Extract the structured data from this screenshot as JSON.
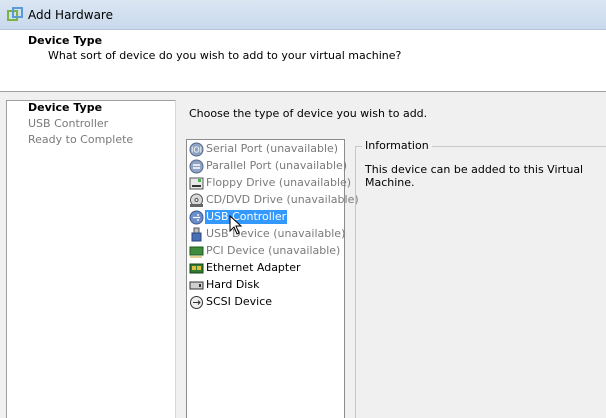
{
  "window": {
    "title": "Add Hardware",
    "icon": "vmware-logo-icon"
  },
  "header": {
    "title": "Device Type",
    "subtitle": "What sort of device do you wish to add to your virtual machine?"
  },
  "steps": [
    {
      "label": "Device Type",
      "state": "active"
    },
    {
      "label": "USB Controller",
      "state": "pending"
    },
    {
      "label": "Ready to Complete",
      "state": "pending"
    }
  ],
  "main": {
    "instruction": "Choose the type of device you wish to add.",
    "devices": [
      {
        "label": "Serial Port (unavailable)",
        "icon": "serial-port-icon",
        "available": false,
        "selected": false
      },
      {
        "label": "Parallel Port (unavailable)",
        "icon": "parallel-port-icon",
        "available": false,
        "selected": false
      },
      {
        "label": "Floppy Drive (unavailable)",
        "icon": "floppy-drive-icon",
        "available": false,
        "selected": false
      },
      {
        "label": "CD/DVD Drive (unavailable)",
        "icon": "cd-dvd-drive-icon",
        "available": false,
        "selected": false
      },
      {
        "label": "USB Controller",
        "icon": "usb-controller-icon",
        "available": true,
        "selected": true
      },
      {
        "label": "USB Device (unavailable)",
        "icon": "usb-device-icon",
        "available": false,
        "selected": false
      },
      {
        "label": "PCI Device (unavailable)",
        "icon": "pci-device-icon",
        "available": false,
        "selected": false
      },
      {
        "label": "Ethernet Adapter",
        "icon": "ethernet-adapter-icon",
        "available": true,
        "selected": false
      },
      {
        "label": "Hard Disk",
        "icon": "hard-disk-icon",
        "available": true,
        "selected": false
      },
      {
        "label": "SCSI Device",
        "icon": "scsi-device-icon",
        "available": true,
        "selected": false
      }
    ],
    "information": {
      "legend": "Information",
      "text": "This device can be added to this Virtual Machine."
    }
  },
  "colors": {
    "selection": "#3399ff",
    "disabled_text": "#7a7a7a",
    "header_bg": "#ffffff",
    "window_bg": "#f0f0f0"
  }
}
